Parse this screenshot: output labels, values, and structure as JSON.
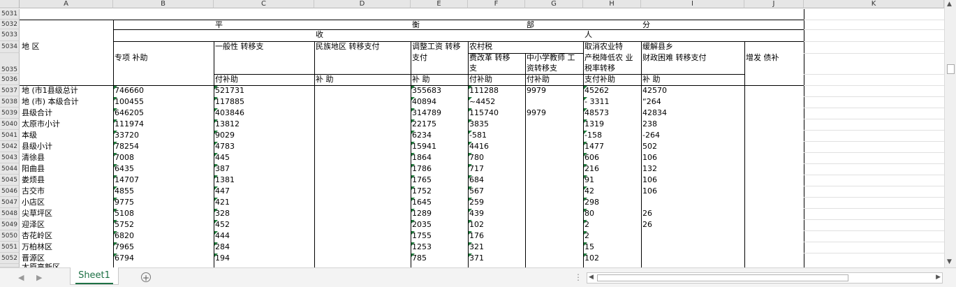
{
  "columns": [
    "A",
    "B",
    "C",
    "D",
    "E",
    "F",
    "G",
    "H",
    "I",
    "J",
    "K"
  ],
  "row_numbers": [
    "5031",
    "5032",
    "5033",
    "5034",
    "5035",
    "5036",
    "5037",
    "5038",
    "5039",
    "5040",
    "5041",
    "5042",
    "5043",
    "5044",
    "5045",
    "5046",
    "5047",
    "5048",
    "5049",
    "5050",
    "5051",
    "5052"
  ],
  "header": {
    "r5032": [
      "平",
      "衡",
      "部",
      "分"
    ],
    "r5033": [
      "收",
      "人"
    ],
    "region": "地 区",
    "b_label": "专项 补助",
    "c_label": "一般性 转移支",
    "c_bottom": "付补助",
    "d_label": "民族地区 转移支付",
    "d_bottom": "补 助",
    "e_label": "调整工资 转移",
    "e_label2": "支付",
    "e_bottom": "补 助",
    "fg_group": "农村税",
    "f_label": "费改革 转移",
    "f_label2": "支",
    "f_bottom": "付补助",
    "g_label": "中小学教师 工",
    "g_label2": "资转移支",
    "g_bottom": "付补助",
    "h_label": "取消农业特",
    "h_label2": "产税降低农 业",
    "h_label3": "税率转移",
    "h_bottom": "支付补助",
    "i_label": "缓解县乡",
    "i_label2": "财政困难 转移支付",
    "i_bottom": "补 助",
    "j_label": "增发 债补"
  },
  "rows": [
    {
      "name": "地 (市1县级总计",
      "b": "746660",
      "c": "521731",
      "e": "355683",
      "f": "111288",
      "g": "9979",
      "h": "45262",
      "i": "42570"
    },
    {
      "name": "地 (市) 本级合计",
      "b": "100455",
      "c": "117885",
      "e": "40894",
      "f": "~4452",
      "g": "",
      "h": "-  3311",
      "i": "“264"
    },
    {
      "name": "县级合计",
      "b": "646205",
      "c": "403846",
      "e": "314789",
      "f": "115740",
      "g": "9979",
      "h": "48573",
      "i": "42834"
    },
    {
      "name": "太原市小计",
      "b": "111974",
      "c": "13812",
      "e": "22175",
      "f": "3835",
      "g": "",
      "h": "1319",
      "i": "238"
    },
    {
      "name": "本级",
      "b": "33720",
      "c": "9029",
      "e": "6234",
      "f": "-581",
      "g": "",
      "h": "-158",
      "i": "-264"
    },
    {
      "name": "县级小计",
      "b": "78254",
      "c": "4783",
      "e": "15941",
      "f": "4416",
      "g": "",
      "h": "1477",
      "i": "502"
    },
    {
      "name": "清徐县",
      "b": "7008",
      "c": "445",
      "e": "1864",
      "f": "780",
      "g": "",
      "h": "606",
      "i": "106"
    },
    {
      "name": "阳曲县",
      "b": "6435",
      "c": "387",
      "e": "1786",
      "f": "717",
      "g": "",
      "h": "216",
      "i": "132"
    },
    {
      "name": "娄烦县",
      "b": "14707",
      "c": "1381",
      "e": "1765",
      "f": "684",
      "g": "",
      "h": "91",
      "i": "106"
    },
    {
      "name": "古交市",
      "b": "4855",
      "c": "447",
      "e": "1752",
      "f": "567",
      "g": "",
      "h": "42",
      "i": "106"
    },
    {
      "name": "小店区",
      "b": "9775",
      "c": "421",
      "e": "1645",
      "f": "259",
      "g": "",
      "h": "298",
      "i": ""
    },
    {
      "name": "尖草坪区",
      "b": "5108",
      "c": "328",
      "e": "1289",
      "f": "439",
      "g": "",
      "h": "80",
      "i": "26"
    },
    {
      "name": "迎泽区",
      "b": "5752",
      "c": "452",
      "e": "2035",
      "f": "102",
      "g": "",
      "h": "2",
      "i": "26"
    },
    {
      "name": "杏花岭区",
      "b": "6820",
      "c": "444",
      "e": "1755",
      "f": "176",
      "g": "",
      "h": "2",
      "i": ""
    },
    {
      "name": "万柏林区",
      "b": "7965",
      "c": "284",
      "e": "1253",
      "f": "321",
      "g": "",
      "h": "15",
      "i": ""
    },
    {
      "name": "晋源区",
      "b": "6794",
      "c": "194",
      "e": "785",
      "f": "371",
      "g": "",
      "h": "102",
      "i": ""
    }
  ],
  "partial_row_name": "太原高新区",
  "sheet_tab": "Sheet1",
  "add_sheet_symbol": "+"
}
